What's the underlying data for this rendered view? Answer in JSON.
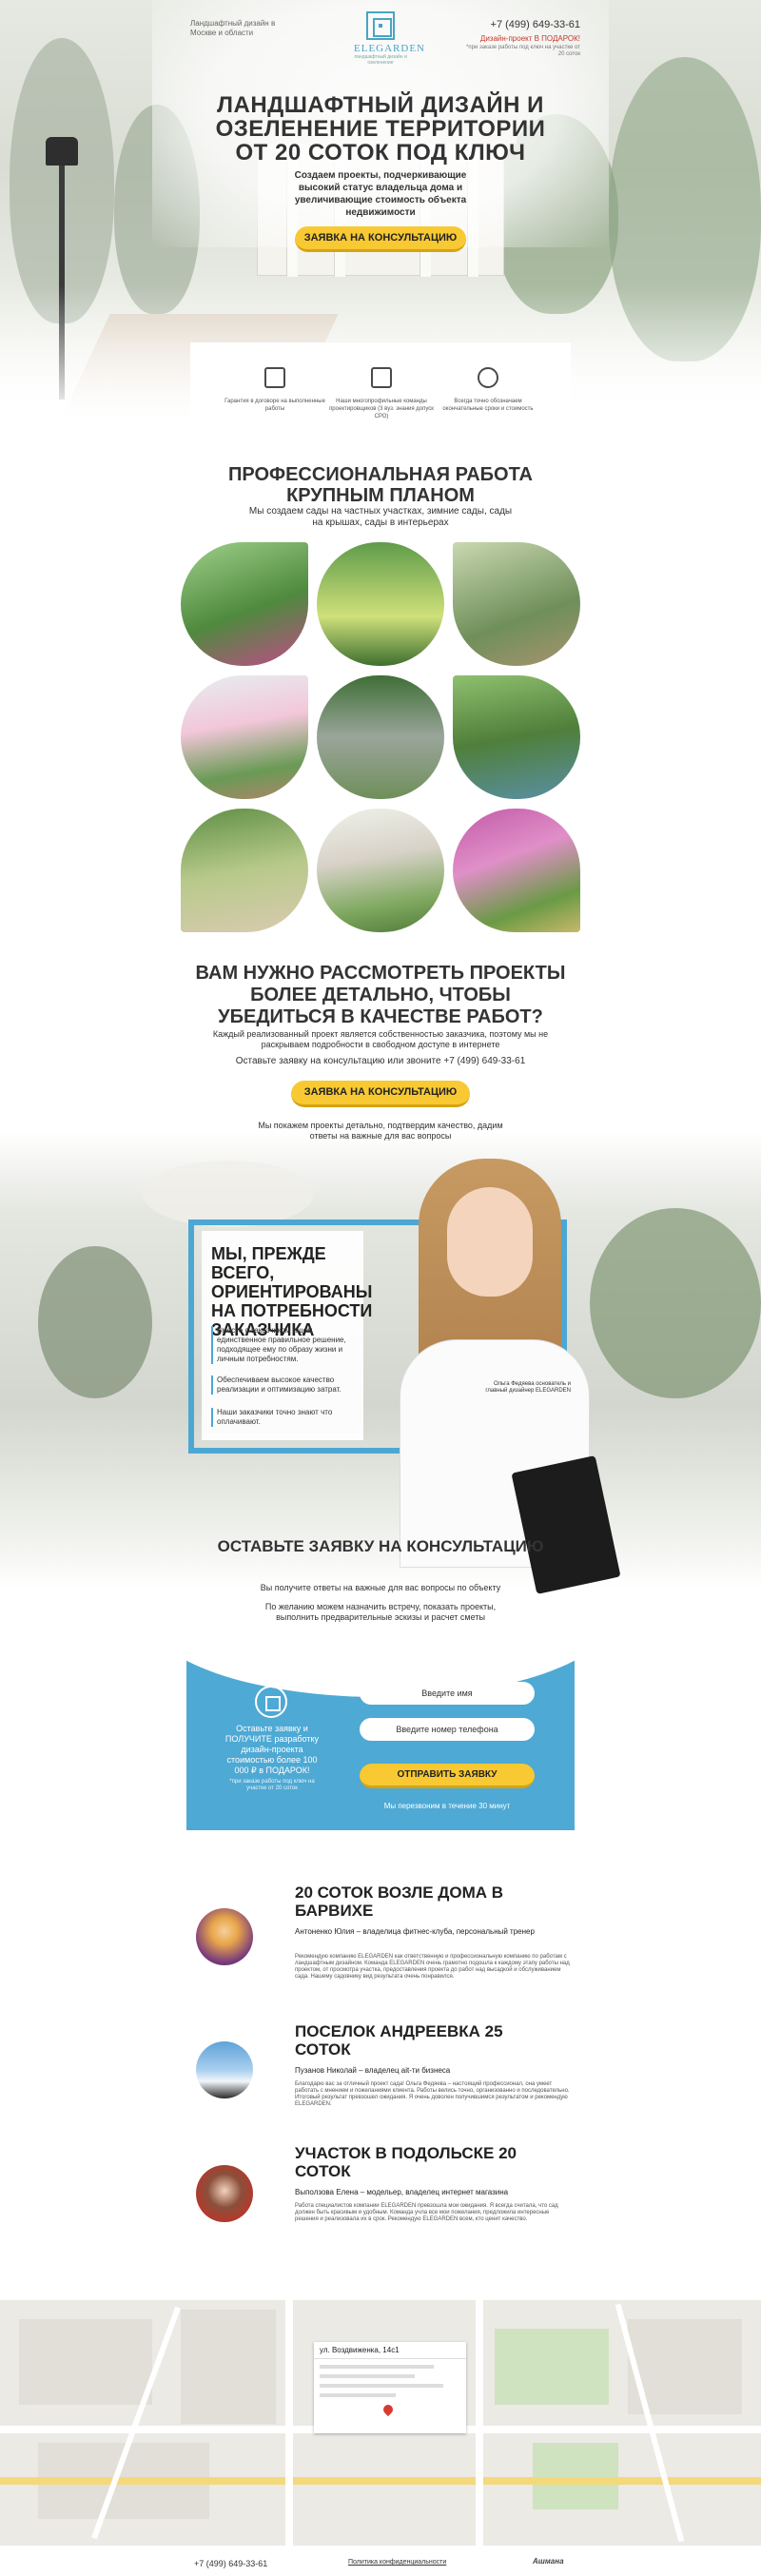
{
  "header": {
    "tagline": "Ландшафтный дизайн в Москве и области",
    "logo_name": "ELEGARDEN",
    "logo_sub": "ландшафтный дизайн и озеленение",
    "phone": "+7 (499) 649-33-61",
    "gift": "Дизайн-проект В ПОДАРОК!",
    "gift_note": "*при заказе работы под ключ на участке от 20 соток"
  },
  "hero": {
    "title": "ЛАНДШАФТНЫЙ ДИЗАЙН И ОЗЕЛЕНЕНИЕ ТЕРРИТОРИИ ОТ 20 СОТОК ПОД КЛЮЧ",
    "subtitle": "Создаем проекты, подчеркивающие высокий статус владельца дома и увеличивающие стоимость объекта недвижимости",
    "button": "ЗАЯВКА НА КОНСУЛЬТАЦИЮ"
  },
  "features": [
    {
      "icon": "contract-icon",
      "text": "Гарантия в договоре на выполненные работы"
    },
    {
      "icon": "document-icon",
      "text": "Наши многопрофильные команды проектировщиков (3 вуз. знания допуск СРО)"
    },
    {
      "icon": "clock-icon",
      "text": "Всегда точно обозначаем окончательные сроки и стоимость"
    }
  ],
  "professional": {
    "title": "ПРОФЕССИОНАЛЬНАЯ РАБОТА КРУПНЫМ ПЛАНОМ",
    "subtitle": "Мы создаем сады на частных участках, зимние сады, сады на крышах, сады в интерьерах"
  },
  "detail": {
    "title": "ВАМ НУЖНО РАССМОТРЕТЬ ПРОЕКТЫ БОЛЕЕ ДЕТАЛЬНО, ЧТОБЫ УБЕДИТЬСЯ В КАЧЕСТВЕ РАБОТ?",
    "subtitle": "Каждый реализованный проект является собственностью заказчика, поэтому мы не раскрываем подробности в свободном доступе в интернете",
    "call": "Оставьте заявку на консультацию или звоните +7 (499) 649-33-61",
    "button": "ЗАЯВКА НА КОНСУЛЬТАЦИЮ",
    "note": "Мы покажем проекты детально, подтвердим качество, дадим ответы на важные для вас вопросы"
  },
  "needs": {
    "title": "МЫ, ПРЕЖДЕ ВСЕГО, ОРИЕНТИРОВАНЫ НА ПОТРЕБНОСТИ ЗАКАЗЧИКА",
    "p1": "Вместе с заказчиком ищем единственное правильное решение, подходящее ему по образу жизни и личным потребностям.",
    "p2": "Обеспечиваем высокое качество реализации и оптимизацию затрат.",
    "p3": "Наши заказчики точно знают что оплачивают.",
    "caption": "Ольга Федяева основатель и главный дизайнер ELEGARDEN"
  },
  "form": {
    "title": "ОСТАВЬТЕ ЗАЯВКУ НА КОНСУЛЬТАЦИЮ",
    "sub1": "Вы получите ответы на важные для вас вопросы по объекту",
    "sub2": "По желанию можем назначить встречу, показать проекты, выполнить предварительные эскизы и расчет сметы",
    "gift_text": "Оставьте заявку и ПОЛУЧИТЕ разработку дизайн-проекта стоимостью более 100 000 ₽ в ПОДАРОК!",
    "gift_small": "*при заказе работы под ключ на участке от 20 соток",
    "name_placeholder": "Введите имя",
    "phone_placeholder": "Введите номер телефона",
    "button": "ОТПРАВИТЬ ЗАЯВКУ",
    "note": "Мы перезвоним в течение 30 минут"
  },
  "reviews": [
    {
      "title": "20 СОТОК ВОЗЛЕ ДОМА В БАРВИХЕ",
      "author": "Антоненко Юлия – владелица фитнес-клуба, персональный тренер",
      "text": "Рекомендую компанию ELEGARDEN как ответственную и профессиональную компанию по работам с ландшафтным дизайном. Команда ELEGARDEN очень грамотно подошла к каждому этапу работы над проектом, от просмотра участка, предоставления проекта до работ над высадкой и обслуживанием сада. Нашему садовнику вид результата очень понравился."
    },
    {
      "title": "ПОСЕЛОК АНДРЕЕВКА 25 СОТОК",
      "author": "Пузанов Николай – владелец ait-ти бизнеса",
      "text": "Благодарю вас за отличный проект сада! Ольга Федяева – настоящий профессионал, она умеет работать с мнением и пожеланиями клиента. Работы велись точно, организованно и последовательно. Итоговый результат превзошел ожидания. Я очень доволен получившимся результатом и рекомендую ELEGARDEN."
    },
    {
      "title": "УЧАСТОК В ПОДОЛЬСКЕ 20 СОТОК",
      "author": "Выползова Елена – модельер, владелец интернет магазина",
      "text": "Работа специалистов компании ELEGARDEN превзошла мои ожидания. Я всегда считала, что сад должен быть красивым и удобным. Команда учла все мои пожелания, предложила интересные решения и реализовала их в срок. Рекомендую ELEGARDEN всем, кто ценит качество."
    }
  ],
  "map": {
    "address": "ул. Воздвиженка, 14с1"
  },
  "footer": {
    "phone": "+7 (499) 649-33-61",
    "policy": "Политика конфиденциальности",
    "brand": "Ашмана"
  },
  "colors": {
    "accent_blue": "#4ea9d4",
    "button_yellow": "#f8c932",
    "gift_red": "#c0392b"
  }
}
